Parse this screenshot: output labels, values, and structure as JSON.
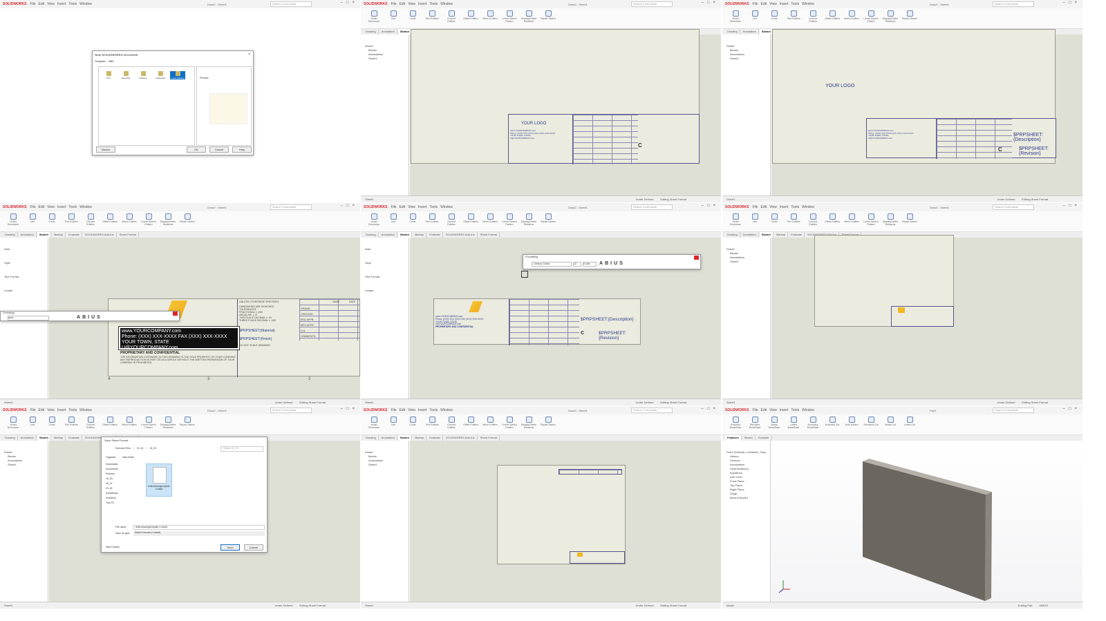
{
  "chrome": {
    "drawing": {
      "app_name": "SOLIDWORKS",
      "menu": [
        "File",
        "Edit",
        "View",
        "Insert",
        "Tools",
        "Window"
      ],
      "doc_title": "Draw2 - Sheet1",
      "search_placeholder": "Search Commands",
      "ribbon": [
        "Smart Dimension",
        "Line",
        "Circle",
        "Trim Entities",
        "Convert Entities",
        "Offset Entities",
        "Mirror Entities",
        "Linear Sketch Pattern",
        "Display/Delete Relations",
        "Repair Sketch"
      ],
      "tabs": [
        "Drawing",
        "Annotation",
        "Sketch",
        "Markup",
        "Evaluate",
        "SOLIDWORKS Add-Ins",
        "Sheet Format"
      ],
      "active_tab": 2,
      "tree": [
        "Draw2",
        "Blocks",
        "Annotations",
        "Sheet1"
      ],
      "status": [
        "Under Defined",
        "Editing Sheet Format"
      ],
      "sheet_tab": "Sheet1"
    },
    "part": {
      "app_name": "SOLIDWORKS",
      "menu": [
        "File",
        "Edit",
        "View",
        "Insert",
        "Tools",
        "Window"
      ],
      "doc_title": "Part1",
      "search_placeholder": "Search Commands",
      "ribbon": [
        "Extruded Boss/Base",
        "Revolved Boss/Base",
        "Swept Boss/Base",
        "Lofted Boss/Base",
        "Boundary Boss/Base",
        "Extruded Cut",
        "Hole Wizard",
        "Revolved Cut",
        "Swept Cut",
        "Lofted Cut"
      ],
      "tabs": [
        "Features",
        "Sketch",
        "Evaluate"
      ],
      "active_tab": 0,
      "tree": [
        "Part1 (Default) <<Default>_Disp",
        "History",
        "Sensors",
        "Annotations",
        "Solid Bodies(1)",
        "Equations",
        "AISI 1020",
        "Front Plane",
        "Top Plane",
        "Right Plane",
        "Origin",
        "Boss-Extrude1"
      ],
      "status": [
        "Editing Part",
        "MMGS"
      ],
      "sheet_tab": "Model"
    }
  },
  "new_doc_dialog": {
    "title": "New SOLIDWORKS Document",
    "tabs": [
      "Templates",
      "MBD"
    ],
    "templates": [
      "Part",
      "Assembly",
      "Drawing",
      "Landscape",
      "Letter-drawing"
    ],
    "selected_index": 4,
    "preview_label": "Preview",
    "buttons": {
      "novice": "Novice",
      "ok": "OK",
      "cancel": "Cancel",
      "help": "Help"
    }
  },
  "title_block": {
    "logo_text": "YOUR LOGO",
    "company": [
      "www.YOURCOMPANY.com",
      "Phone: (XXX) XXX-XXXX  FAX (XXX) XXX-XXXX",
      "YOUR TOWN, STATE",
      "U@YOURCOMPANY.com"
    ],
    "proprietary_title": "PROPRIETARY AND CONFIDENTIAL",
    "proprietary_text": "THE INFORMATION CONTAINED IN THIS DRAWING IS THE SOLE PROPERTY OF YOUR COMPANY. ANY REPRODUCTION IN PART OR AS A WHOLE WITHOUT THE WRITTEN PERMISSION OF YOUR COMPANY IS PROHIBITED.",
    "unless_specified": "UNLESS OTHERWISE SPECIFIED:",
    "tolerances": [
      "DIMENSIONS ARE IN INCHES",
      "TOLERANCES:",
      "FRACTIONAL ± 1/64",
      "ANGULAR: ± .5°",
      "TWO PLACE DECIMAL  ± .01",
      "THREE PLACE DECIMAL  ± .005"
    ],
    "rows": [
      "DRAWN",
      "CHECKED",
      "ENG APPR.",
      "MFG APPR.",
      "Q.A.",
      "COMMENTS:"
    ],
    "col_name": "NAME",
    "col_date": "DATE",
    "material": "$PRPSHEET:{Material}",
    "finish": "$PRPSHEET:{Finish}",
    "do_not_scale": "DO NOT SCALE DRAWING",
    "description": "$PRPSHEET:{Description}",
    "revision": "$PRPSHEET:{Revision}",
    "size": "C",
    "zone_numbers": [
      "4",
      "3",
      "2"
    ]
  },
  "note_pm": {
    "title": "Note",
    "sections": [
      "Style",
      "Text Format",
      "Leader"
    ]
  },
  "formatting": {
    "title": "Formatting",
    "font": "Century Gothic",
    "size": "10",
    "height": "0.18in",
    "font_left": "Arial",
    "buttons": [
      "A",
      "B",
      "I",
      "U",
      "S"
    ]
  },
  "save_dialog": {
    "title": "Save Sheet Format",
    "path": [
      "Exercise Files",
      "Ch 15",
      "15_03"
    ],
    "search_placeholder": "Search 15_03",
    "organize": "Organize",
    "new_folder": "New folder",
    "nav": [
      "Downloads",
      "Documents",
      "Pictures",
      "15_03",
      "15_07",
      "Ch 15",
      "SolidWorks",
      "OneDrive",
      "This PC"
    ],
    "file_item": "letterdrawingtemplate 2.slddrt",
    "file_name_label": "File name:",
    "file_name": "letterdrawingtemplate 2.slddrt",
    "type_label": "Save as type:",
    "type": "Sheet Formats (*.slddrt)",
    "hide_folders": "Hide Folders",
    "save": "Save",
    "cancel": "Cancel"
  },
  "colors": {
    "accent": "#d8262f",
    "selection": "#0f6fc6",
    "sheet": "#ebebdf",
    "plate": "#6b665f"
  }
}
